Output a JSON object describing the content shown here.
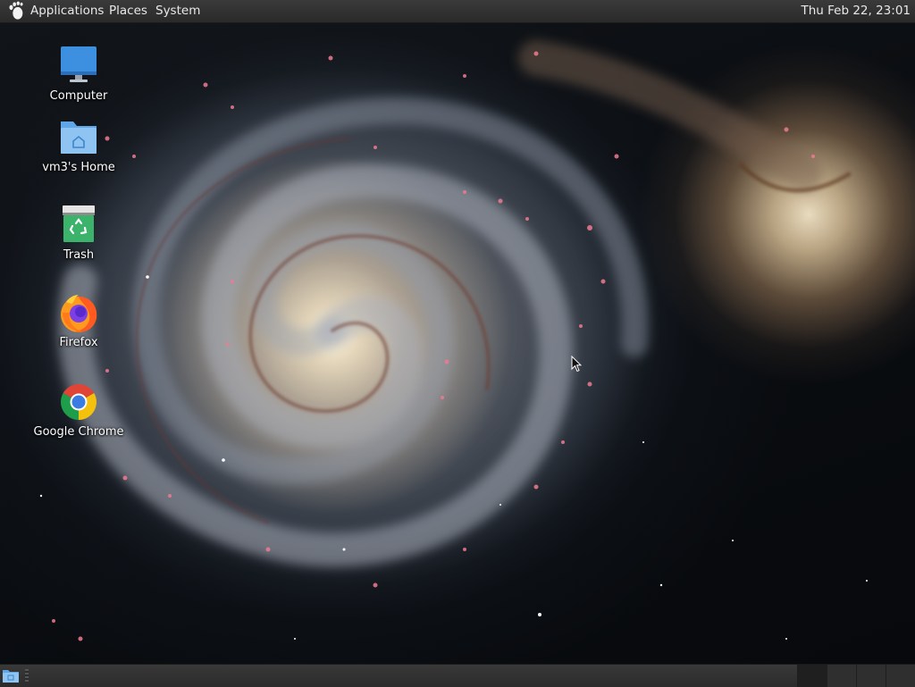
{
  "top_panel": {
    "menus": [
      "Applications",
      "Places",
      "System"
    ],
    "clock": "Thu Feb 22, 23:01",
    "logo_icon": "gnome-foot-icon"
  },
  "desktop": {
    "wallpaper": "spiral-galaxy-wallpaper",
    "icons": [
      {
        "label": "Computer",
        "icon": "computer-monitor-icon"
      },
      {
        "label": "vm3's Home",
        "icon": "home-folder-icon"
      },
      {
        "label": "Trash",
        "icon": "trash-icon"
      },
      {
        "label": "Firefox",
        "icon": "firefox-icon"
      },
      {
        "label": "Google Chrome",
        "icon": "chrome-icon"
      }
    ]
  },
  "bottom_panel": {
    "show_desktop_icon": "show-desktop-icon",
    "workspace_count": 4
  },
  "colors": {
    "panel": "#2f2f2f",
    "panel_text": "#e8e8e8",
    "monitor_blue": "#3d8fe0",
    "folder_blue": "#8ec3f2",
    "trash_green": "#3bb36b"
  }
}
